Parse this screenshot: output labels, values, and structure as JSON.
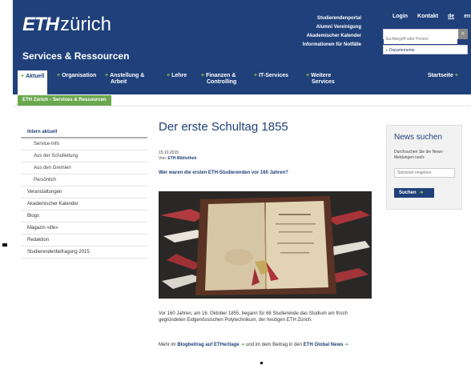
{
  "header": {
    "logo_eth": "ETH",
    "logo_zurich": "zürich",
    "site_title": "Services & Ressourcen",
    "quick_links": [
      "Studierendenportal",
      "Alumni Vereinigung",
      "Akademischer Kalender",
      "Informationen für Notfälle"
    ],
    "util_links": {
      "login": "Login",
      "kontakt": "Kontakt",
      "de": "de",
      "en": "en"
    },
    "search": {
      "placeholder": "Suchbegriff oder Person",
      "button": "⌕"
    },
    "departments": "Departemente"
  },
  "nav": {
    "items": [
      {
        "label": "Aktuell"
      },
      {
        "label": "Organisation"
      },
      {
        "label": "Anstellung &",
        "label2": "Arbeit"
      },
      {
        "label": "Lehre"
      },
      {
        "label": "Finanzen &",
        "label2": "Controlling"
      },
      {
        "label": "IT-Services"
      },
      {
        "label": "Weitere",
        "label2": "Services"
      },
      {
        "label": "Startseite"
      }
    ]
  },
  "breadcrumb": {
    "items": [
      "ETH Zürich",
      "Services & Ressourcen"
    ]
  },
  "sidebar": {
    "items": [
      {
        "label": "Intern aktuell"
      },
      {
        "label": "Service-Info"
      },
      {
        "label": "Aus der Schulleitung"
      },
      {
        "label": "Aus den Gremien"
      },
      {
        "label": "Persönlich"
      },
      {
        "label": "Veranstaltungen"
      },
      {
        "label": "Akademischer Kalender"
      },
      {
        "label": "Blogs"
      },
      {
        "label": "Magazin «life»"
      },
      {
        "label": "Redaktion"
      },
      {
        "label": "Studierendenbefragung 2015"
      }
    ]
  },
  "article": {
    "title": "Der erste Schultag 1855",
    "date": "15.10.2015",
    "author_prefix": "Von:",
    "author": "ETH-Bibliothek",
    "lead": "Wer waren die ersten ETH-Studierenden vor 160 Jahren?",
    "body": "Vor 160 Jahren, am 16. Oktober 1855, begann für 68 Studierende das Studium am frisch gegründeten Eidgenössischen Polytechnikum, der heutigen ETH Zürich.",
    "more_prefix": "Mehr im",
    "more_link1": "Blogbeitrag auf ETHeritage",
    "more_mid": "und im dem Beitrag in den",
    "more_link2": "ETH Global News"
  },
  "news_search": {
    "title": "News suchen",
    "desc": "Durchsuchen Sie die News-Meldungen nach:",
    "placeholder": "Stichwort eingeben",
    "button": "Suchen"
  },
  "colors": {
    "brand_blue": "#1f407a",
    "accent_green": "#6aa84f"
  }
}
